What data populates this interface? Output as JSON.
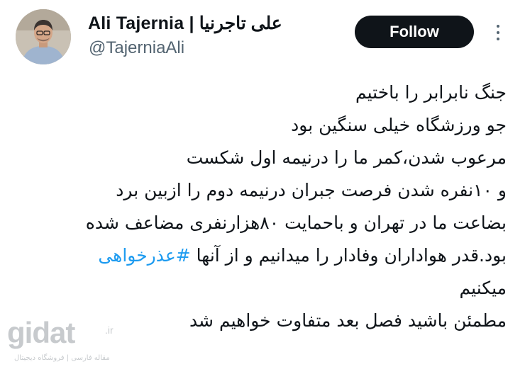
{
  "author": {
    "display_name": "Ali Tajernia | علی تاجرنیا",
    "handle": "@TajerniaAli",
    "avatar_icon": "profile-photo"
  },
  "actions": {
    "follow_label": "Follow",
    "more_icon": "more-vertical-icon"
  },
  "tweet": {
    "lines": [
      "جنگ نابرابر را باختیم",
      "جو ورزشگاه خیلی سنگین بود",
      "مرعوب شدن،کمر ما را درنیمه اول شکست",
      "و ۱۰نفره شدن فرصت جبران درنیمه دوم را ازبین برد",
      "بضاعت ما در تهران و باحمایت ۸۰هزارنفری مضاعف شده",
      "بود.قدر هواداران وفادار را میدانیم و از آنها",
      "میکنیم",
      "مطمئن باشید فصل بعد متفاوت خواهیم شد"
    ],
    "hashtag": "#عذرخواهی"
  },
  "watermark": {
    "logo": "gidat",
    "tld": ".ir",
    "tagline": "مقاله فارسی | فروشگاه دیجیتال"
  },
  "colors": {
    "text": "#0f1419",
    "secondary": "#536471",
    "link": "#1d9bf0",
    "follow_bg": "#0f1419"
  }
}
